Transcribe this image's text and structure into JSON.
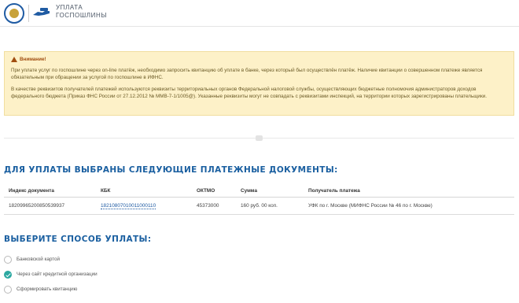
{
  "header": {
    "title_line1": "УПЛАТА",
    "title_line2": "ГОСПОШЛИНЫ"
  },
  "warning": {
    "title": "Внимание!",
    "paragraph1": "При уплате услуг по госпошлине через on-line платёж, необходимо запросить квитанцию об уплате в банке, через который был осуществлён платёж. Наличие квитанции о совершенном платеже является обязательным при обращении за услугой по госпошлине в ИФНС.",
    "paragraph2": "В качестве реквизитов получателей платежей используются реквизиты территориальных органов Федеральной налоговой службы, осуществляющих бюджетные полномочия администраторов доходов федерального бюджета (Приказ ФНС России от 27.12.2012 № ММВ-7-1/1005@). Указанные реквизиты могут не совпадать с реквизитами инспекций, на территории которых зарегистрированы плательщики."
  },
  "documents": {
    "title": "ДЛЯ УПЛАТЫ ВЫБРАНЫ СЛЕДУЮЩИЕ ПЛАТЕЖНЫЕ ДОКУМЕНТЫ:",
    "columns": [
      "Индекс документа",
      "КБК",
      "ОКТМО",
      "Сумма",
      "Получатель платежа"
    ],
    "rows": [
      {
        "index": "18209965200850539937",
        "kbk": "18210807010011000110",
        "oktmo": "45373000",
        "sum": "160 руб. 00 коп.",
        "recipient": "УФК по г. Москве (МИФНС России № 46 по г. Москве)"
      }
    ]
  },
  "payment": {
    "title": "ВЫБЕРИТЕ СПОСОБ УПЛАТЫ:",
    "options": [
      {
        "label": "Банковской картой",
        "checked": false
      },
      {
        "label": "Через сайт кредитной организации",
        "checked": true
      },
      {
        "label": "Сформировать квитанцию",
        "checked": false
      }
    ]
  },
  "colors": {
    "accent": "#1a5fa0",
    "warning_bg": "#fdf1c8",
    "checked": "#2da8a1"
  }
}
